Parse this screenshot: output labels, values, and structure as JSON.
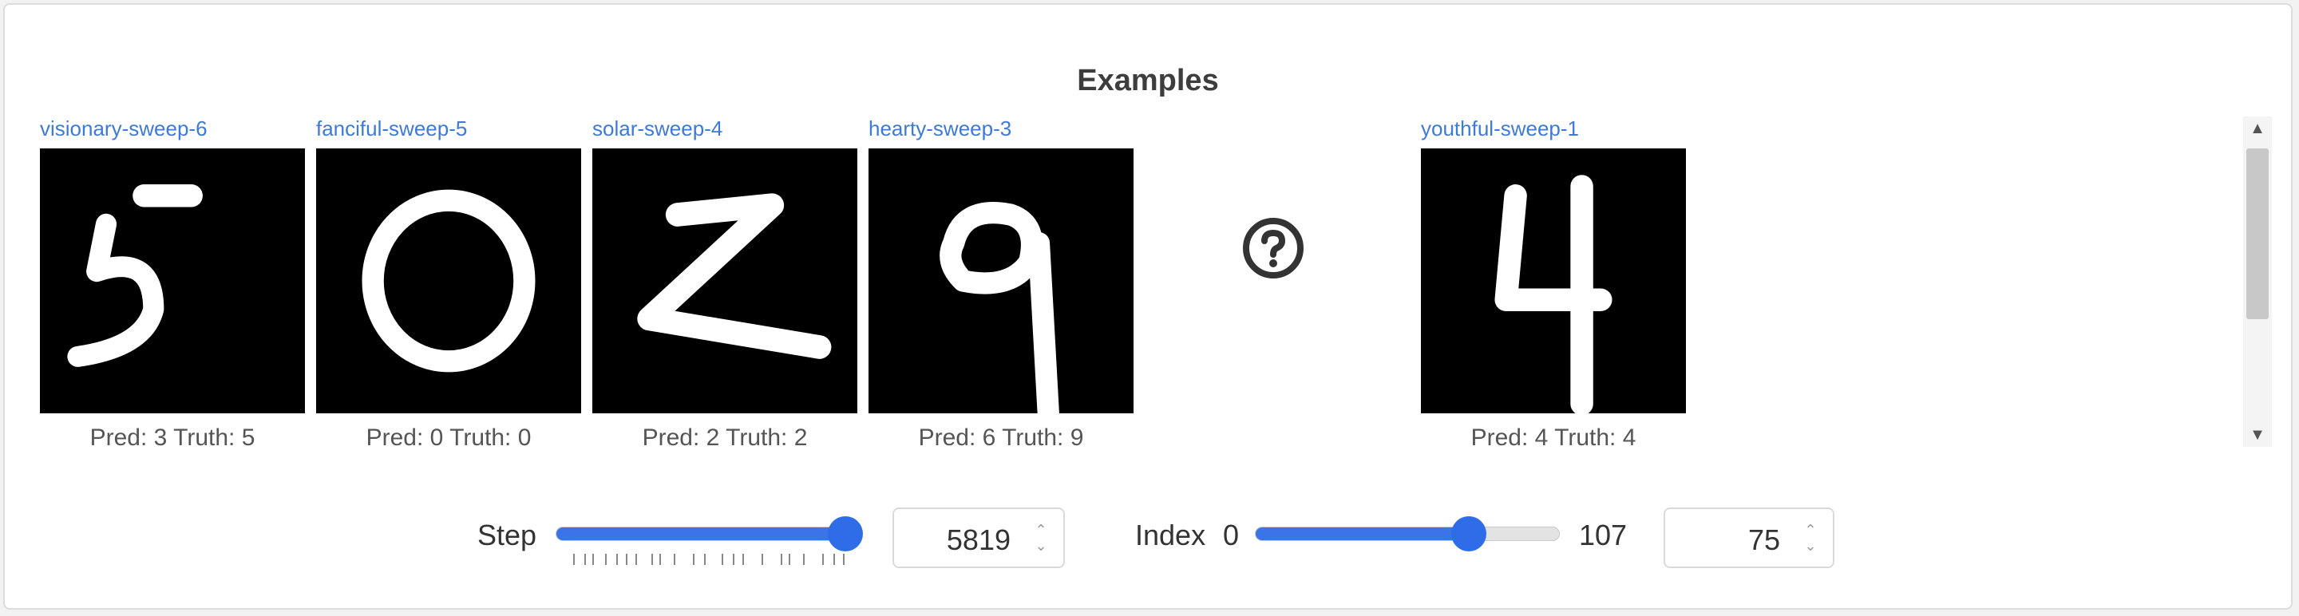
{
  "panel": {
    "title": "Examples"
  },
  "examples": [
    {
      "run": "visionary-sweep-6",
      "caption": "Pred: 3 Truth: 5",
      "digit": "5"
    },
    {
      "run": "fanciful-sweep-5",
      "caption": "Pred: 0 Truth: 0",
      "digit": "0"
    },
    {
      "run": "solar-sweep-4",
      "caption": "Pred: 2 Truth: 2",
      "digit": "2"
    },
    {
      "run": "hearty-sweep-3",
      "caption": "Pred: 6 Truth: 9",
      "digit": "9"
    },
    {
      "run": "",
      "caption": "",
      "digit": null,
      "missing_icon": "question-circle-icon"
    },
    {
      "run": "youthful-sweep-1",
      "caption": "Pred: 4 Truth: 4",
      "digit": "4"
    }
  ],
  "controls": {
    "step": {
      "label": "Step",
      "value": "5819",
      "position_fraction": 1.0
    },
    "index": {
      "label": "Index",
      "min": "0",
      "max": "107",
      "value": "75",
      "position_fraction": 0.7
    }
  },
  "colors": {
    "accent": "#2f6de8",
    "link": "#3e7ad8"
  },
  "icons": {
    "spinner": "chevron-up-down-icon",
    "scroll_up": "triangle-up-icon",
    "scroll_down": "triangle-down-icon"
  }
}
